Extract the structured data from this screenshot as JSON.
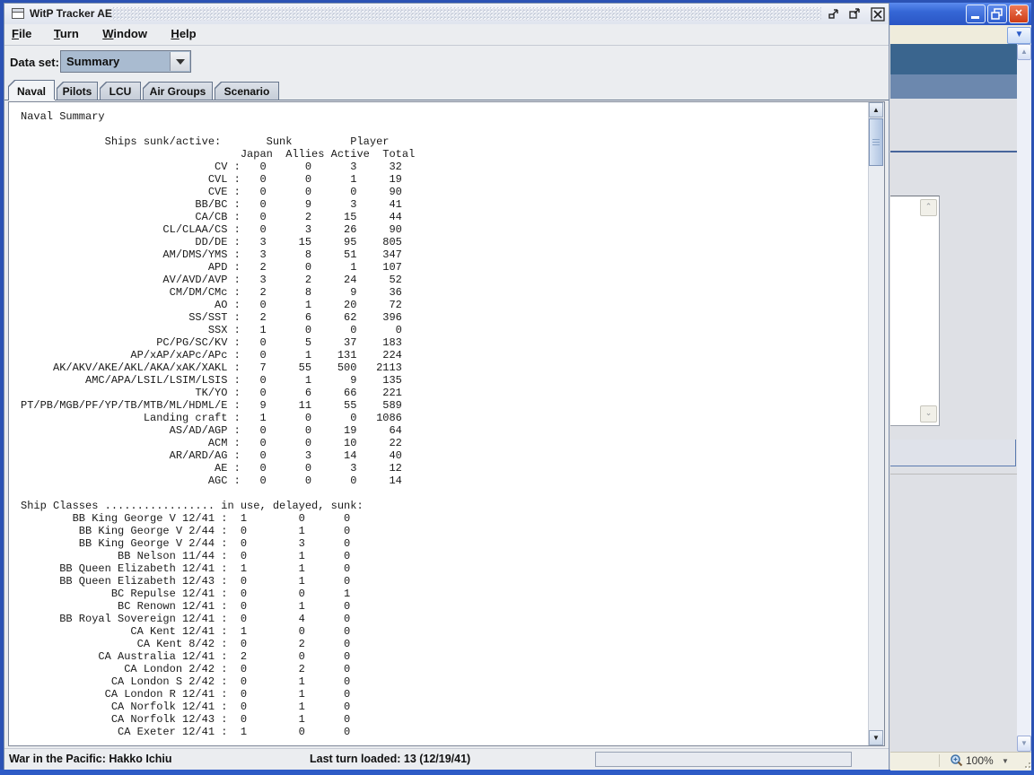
{
  "colors": {
    "xp_border_blue": "#2B52B4",
    "xp_titlebar_blue": "#3567D6",
    "xp_close_red": "#CE3C16",
    "metal_selection": "#A9BBD0",
    "metal_panel": "#EBEDF0"
  },
  "window": {
    "title": "WitP Tracker AE"
  },
  "menu": {
    "items": [
      {
        "head": "F",
        "rest": "ile"
      },
      {
        "head": "T",
        "rest": "urn"
      },
      {
        "head": "W",
        "rest": "indow"
      },
      {
        "head": "H",
        "rest": "elp"
      }
    ]
  },
  "dataset": {
    "label": "Data set:",
    "value": "Summary"
  },
  "tabs": {
    "selected_index": 0,
    "items": [
      {
        "label": "Naval"
      },
      {
        "label": "Pilots"
      },
      {
        "label": "LCU"
      },
      {
        "label": "Air Groups"
      },
      {
        "label": "Scenario"
      }
    ]
  },
  "report": {
    "title_line": "Naval Summary",
    "ships_table": {
      "section_header": "Ships sunk/active:",
      "group_headers": [
        "Sunk",
        "Player"
      ],
      "columns": [
        "Japan",
        "Allies",
        "Active",
        "Total"
      ],
      "rows": [
        [
          "CV",
          0,
          0,
          3,
          32
        ],
        [
          "CVL",
          0,
          0,
          1,
          19
        ],
        [
          "CVE",
          0,
          0,
          0,
          90
        ],
        [
          "BB/BC",
          0,
          9,
          3,
          41
        ],
        [
          "CA/CB",
          0,
          2,
          15,
          44
        ],
        [
          "CL/CLAA/CS",
          0,
          3,
          26,
          90
        ],
        [
          "DD/DE",
          3,
          15,
          95,
          805
        ],
        [
          "AM/DMS/YMS",
          3,
          8,
          51,
          347
        ],
        [
          "APD",
          2,
          0,
          1,
          107
        ],
        [
          "AV/AVD/AVP",
          3,
          2,
          24,
          52
        ],
        [
          "CM/DM/CMc",
          2,
          8,
          9,
          36
        ],
        [
          "AO",
          0,
          1,
          20,
          72
        ],
        [
          "SS/SST",
          2,
          6,
          62,
          396
        ],
        [
          "SSX",
          1,
          0,
          0,
          0
        ],
        [
          "PC/PG/SC/KV",
          0,
          5,
          37,
          183
        ],
        [
          "AP/xAP/xAPc/APc",
          0,
          1,
          131,
          224
        ],
        [
          "AK/AKV/AKE/AKL/AKA/xAK/XAKL",
          7,
          55,
          500,
          2113
        ],
        [
          "AMC/APA/LSIL/LSIM/LSIS",
          0,
          1,
          9,
          135
        ],
        [
          "TK/YO",
          0,
          6,
          66,
          221
        ],
        [
          "PT/PB/MGB/PF/YP/TB/MTB/ML/HDML/E",
          9,
          11,
          55,
          589
        ],
        [
          "Landing craft",
          1,
          0,
          0,
          1086
        ],
        [
          "AS/AD/AGP",
          0,
          0,
          19,
          64
        ],
        [
          "ACM",
          0,
          0,
          10,
          22
        ],
        [
          "AR/ARD/AG",
          0,
          3,
          14,
          40
        ],
        [
          "AE",
          0,
          0,
          3,
          12
        ],
        [
          "AGC",
          0,
          0,
          0,
          14
        ]
      ]
    },
    "ship_classes": {
      "header_label": "Ship Classes",
      "header_cols": "in use, delayed, sunk:",
      "rows": [
        [
          "BB King George V 12/41",
          1,
          0,
          0
        ],
        [
          "BB King George V 2/44",
          0,
          1,
          0
        ],
        [
          "BB King George V 2/44",
          0,
          3,
          0
        ],
        [
          "BB Nelson 11/44",
          0,
          1,
          0
        ],
        [
          "BB Queen Elizabeth 12/41",
          1,
          1,
          0
        ],
        [
          "BB Queen Elizabeth 12/43",
          0,
          1,
          0
        ],
        [
          "BC Repulse 12/41",
          0,
          0,
          1
        ],
        [
          "BC Renown 12/41",
          0,
          1,
          0
        ],
        [
          "BB Royal Sovereign 12/41",
          0,
          4,
          0
        ],
        [
          "CA Kent 12/41",
          1,
          0,
          0
        ],
        [
          "CA Kent 8/42",
          0,
          2,
          0
        ],
        [
          "CA Australia 12/41",
          2,
          0,
          0
        ],
        [
          "CA London 2/42",
          0,
          2,
          0
        ],
        [
          "CA London S 2/42",
          0,
          1,
          0
        ],
        [
          "CA London R 12/41",
          0,
          1,
          0
        ],
        [
          "CA Norfolk 12/41",
          0,
          1,
          0
        ],
        [
          "CA Norfolk 12/43",
          0,
          1,
          0
        ],
        [
          "CA Exeter 12/41",
          1,
          0,
          0
        ]
      ]
    }
  },
  "statusbar": {
    "left": "War in the Pacific: Hakko Ichiu",
    "center": "Last turn loaded: 13 (12/19/41)"
  },
  "browser_status": {
    "zoom": "100%"
  }
}
